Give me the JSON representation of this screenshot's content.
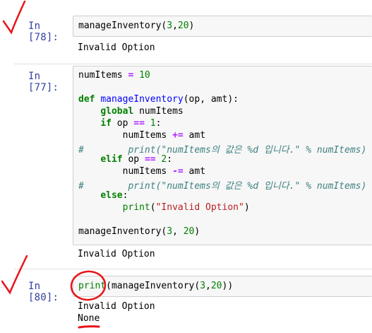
{
  "cells": [
    {
      "prompt": "In [78]:",
      "code": [
        "manageInventory(3,20)"
      ],
      "output": [
        "Invalid Option"
      ]
    },
    {
      "prompt": "In [77]:",
      "code": [
        "numItems = 10",
        "",
        "def manageInventory(op, amt):",
        "    global numItems",
        "    if op == 1:",
        "        numItems += amt",
        "#        print(\"numItems의 값은 %d 입니다.\" % numItems)",
        "    elif op == 2:",
        "        numItems -= amt",
        "#        print(\"numItems의 값은 %d 입니다.\" % numItems)",
        "    else:",
        "        print(\"Invalid Option\")",
        "",
        "manageInventory(3, 20)"
      ],
      "output": [
        "Invalid Option"
      ]
    },
    {
      "prompt": "In [80]:",
      "code": [
        "print(manageInventory(3,20))"
      ],
      "output": [
        "Invalid Option",
        "None"
      ]
    }
  ],
  "colors": {
    "prompt": "#303f9f",
    "keyword": "#008000",
    "operator": "#aa22ff",
    "function_name": "#0000ff",
    "string": "#ba2121",
    "comment": "#408080",
    "annotation": "#e8141b"
  }
}
